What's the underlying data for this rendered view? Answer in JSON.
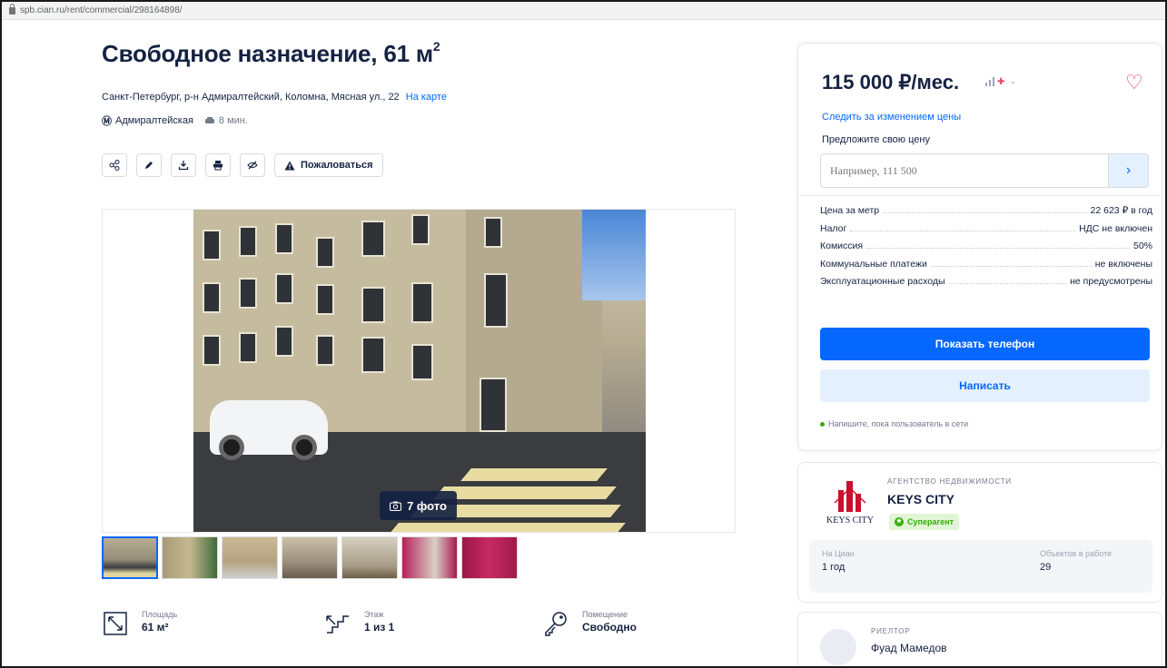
{
  "browser": {
    "url": "spb.cian.ru/rent/commercial/298164898/"
  },
  "listing": {
    "title": "Свободное назначение, 61 м",
    "title_sup": "2",
    "address": "Санкт-Петербург, р-н Адмиралтейский, Коломна, Мясная ул., 22",
    "map_link": "На карте",
    "metro_station": "Адмиралтейская",
    "metro_time": "8 мин."
  },
  "toolbar": {
    "complain_label": "Пожаловаться"
  },
  "gallery": {
    "photo_count_label": "7 фото",
    "thumbnail_count": 7
  },
  "features": [
    {
      "label": "Площадь",
      "value": "61 м²",
      "icon": "area-icon"
    },
    {
      "label": "Этаж",
      "value": "1 из 1",
      "icon": "stairs-icon"
    },
    {
      "label": "Помещение",
      "value": "Свободно",
      "icon": "key-icon"
    }
  ],
  "price_card": {
    "price": "115 000 ₽/мес.",
    "follow_price": "Следить за изменением цены",
    "offer_label": "Предложите свою цену",
    "offer_placeholder": "Например, 111 500",
    "rows": [
      {
        "k": "Цена за метр",
        "v": "22 623 ₽ в год"
      },
      {
        "k": "Налог",
        "v": "НДС не включен"
      },
      {
        "k": "Комиссия",
        "v": "50%"
      },
      {
        "k": "Коммунальные платежи",
        "v": "не включены"
      },
      {
        "k": "Эксплуатационные расходы",
        "v": "не предусмотрены"
      }
    ],
    "show_phone": "Показать телефон",
    "write": "Написать",
    "online_note": "Напишите, пока пользователь в сети"
  },
  "agency": {
    "type": "АГЕНТСТВО НЕДВИЖИМОСТИ",
    "name": "KEYS CITY",
    "logo_text": "KEYS CITY",
    "badge": "Суперагент",
    "stat1_label": "На Циан",
    "stat1_value": "1 год",
    "stat2_label": "Объектов в работе",
    "stat2_value": "29"
  },
  "realtor": {
    "type": "РИЕЛТОР",
    "name": "Фуад Мамедов"
  },
  "colors": {
    "primary": "#0468ff",
    "text": "#152242",
    "heart": "#e84260",
    "online": "#34ac0a"
  }
}
